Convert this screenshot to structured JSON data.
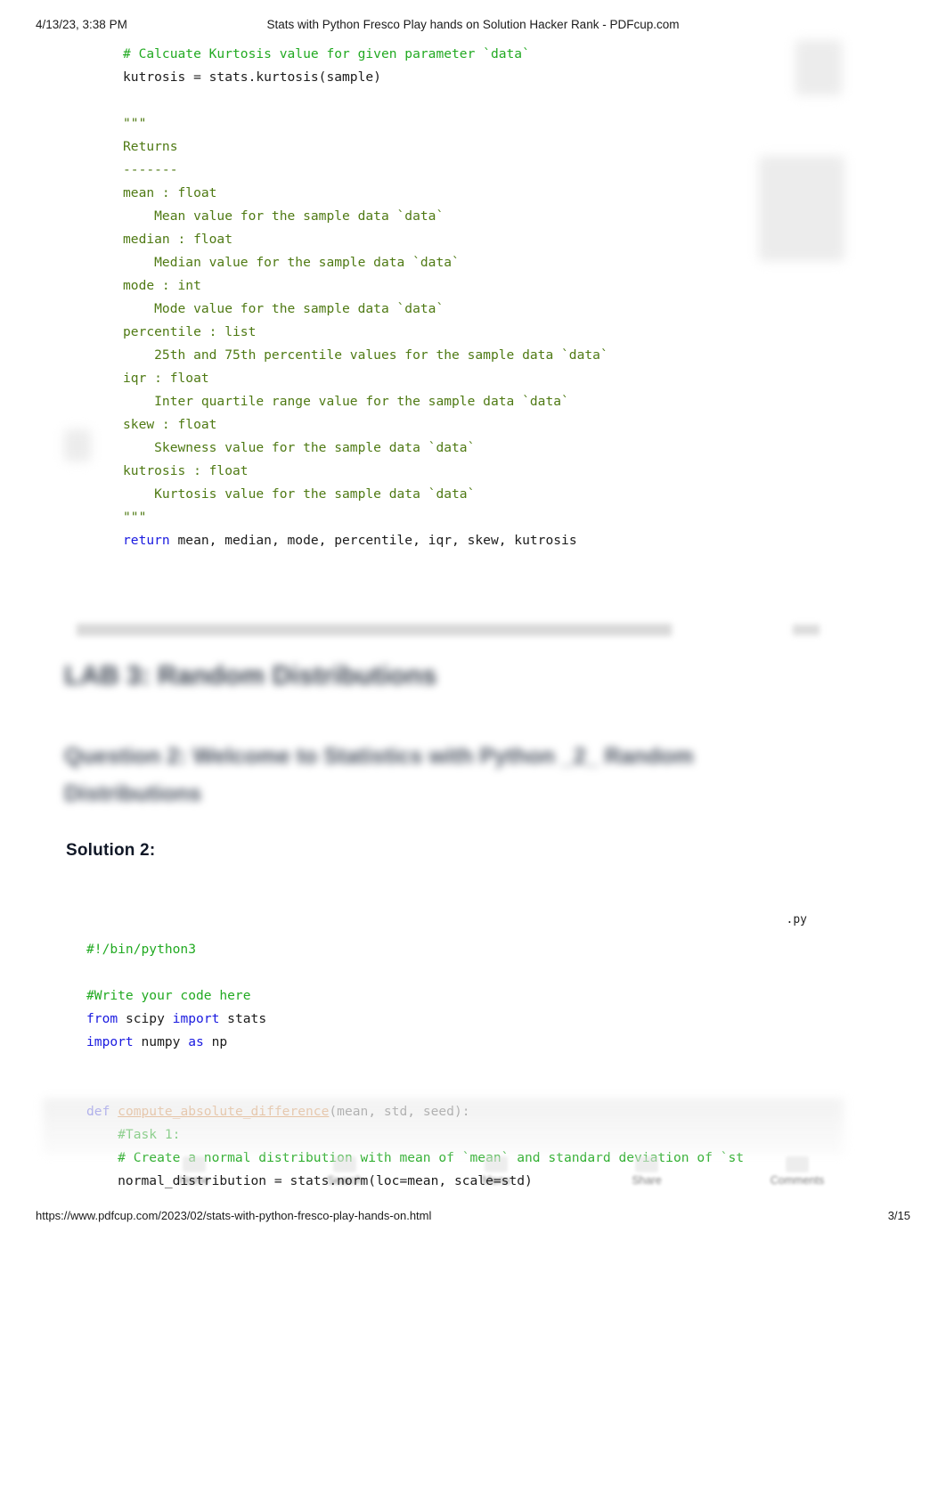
{
  "header": {
    "date": "4/13/23, 3:38 PM",
    "title": "Stats with Python Fresco Play hands on Solution Hacker Rank - PDFcup.com"
  },
  "top_code": {
    "lines": [
      {
        "segments": [
          {
            "t": "# Calcuate Kurtosis value for given parameter `data`",
            "c": "cm"
          }
        ]
      },
      {
        "segments": [
          {
            "t": "kutrosis = stats.kurtosis(sample)",
            "c": "pl"
          }
        ]
      },
      {
        "segments": [
          {
            "t": "",
            "c": "pl"
          }
        ]
      },
      {
        "segments": [
          {
            "t": "\"\"\"",
            "c": "docs"
          }
        ]
      },
      {
        "segments": [
          {
            "t": "Returns",
            "c": "docs"
          }
        ]
      },
      {
        "segments": [
          {
            "t": "-------",
            "c": "docs"
          }
        ]
      },
      {
        "segments": [
          {
            "t": "mean : float",
            "c": "docs"
          }
        ]
      },
      {
        "segments": [
          {
            "t": "    Mean value for the sample data `data`",
            "c": "docs"
          }
        ]
      },
      {
        "segments": [
          {
            "t": "median : float",
            "c": "docs"
          }
        ]
      },
      {
        "segments": [
          {
            "t": "    Median value for the sample data `data`",
            "c": "docs"
          }
        ]
      },
      {
        "segments": [
          {
            "t": "mode : int",
            "c": "docs"
          }
        ]
      },
      {
        "segments": [
          {
            "t": "    Mode value for the sample data `data`",
            "c": "docs"
          }
        ]
      },
      {
        "segments": [
          {
            "t": "percentile : list",
            "c": "docs"
          }
        ]
      },
      {
        "segments": [
          {
            "t": "    25th and 75th percentile values for the sample data `data`",
            "c": "docs"
          }
        ]
      },
      {
        "segments": [
          {
            "t": "iqr : float",
            "c": "docs"
          }
        ]
      },
      {
        "segments": [
          {
            "t": "    Inter quartile range value for the sample data `data`",
            "c": "docs"
          }
        ]
      },
      {
        "segments": [
          {
            "t": "skew : float",
            "c": "docs"
          }
        ]
      },
      {
        "segments": [
          {
            "t": "    Skewness value for the sample data `data`",
            "c": "docs"
          }
        ]
      },
      {
        "segments": [
          {
            "t": "kutrosis : float",
            "c": "docs"
          }
        ]
      },
      {
        "segments": [
          {
            "t": "    Kurtosis value for the sample data `data`",
            "c": "docs"
          }
        ]
      },
      {
        "segments": [
          {
            "t": "\"\"\"",
            "c": "docs"
          }
        ]
      },
      {
        "segments": [
          {
            "t": "return",
            "c": "kw"
          },
          {
            "t": " mean, median, mode, percentile, iqr, skew, kutrosis",
            "c": "pl"
          }
        ]
      }
    ]
  },
  "blurred": {
    "lab_heading": "LAB 3: Random Distributions",
    "question_heading": "Question 2: Welcome to Statistics with Python _2_ Random Distributions"
  },
  "solution": {
    "label": "Solution 2:",
    "file_ext": ".py"
  },
  "bottom_code": {
    "lines": [
      {
        "segments": [
          {
            "t": "#!/bin/python3",
            "c": "cm"
          }
        ]
      },
      {
        "segments": [
          {
            "t": "",
            "c": "pl"
          }
        ]
      },
      {
        "segments": [
          {
            "t": "#Write your code here",
            "c": "cm"
          }
        ]
      },
      {
        "segments": [
          {
            "t": "from",
            "c": "kw"
          },
          {
            "t": " scipy ",
            "c": "pl"
          },
          {
            "t": "import",
            "c": "kw"
          },
          {
            "t": " stats",
            "c": "pl"
          }
        ]
      },
      {
        "segments": [
          {
            "t": "import",
            "c": "kw"
          },
          {
            "t": " numpy ",
            "c": "pl"
          },
          {
            "t": "as",
            "c": "kw"
          },
          {
            "t": " np",
            "c": "pl"
          }
        ]
      },
      {
        "segments": [
          {
            "t": "",
            "c": "pl"
          }
        ]
      },
      {
        "segments": [
          {
            "t": "",
            "c": "pl"
          }
        ]
      },
      {
        "segments": [
          {
            "t": "def",
            "c": "kw"
          },
          {
            "t": " ",
            "c": "pl"
          },
          {
            "t": "compute_absolute_difference",
            "c": "fn"
          },
          {
            "t": "(mean, std, seed):",
            "c": "pl"
          }
        ]
      },
      {
        "segments": [
          {
            "t": "    #Task 1:",
            "c": "cm"
          }
        ]
      },
      {
        "segments": [
          {
            "t": "    # Create a normal distribution with mean of `mean` and standard deviation of `st",
            "c": "cm"
          }
        ]
      },
      {
        "segments": [
          {
            "t": "    normal_distribution = stats.norm(loc=mean, scale=std)",
            "c": "pl"
          }
        ]
      }
    ]
  },
  "toolbar": {
    "items": [
      {
        "label": "Home"
      },
      {
        "label": "Search"
      },
      {
        "label": "Menu"
      },
      {
        "label": "Share"
      },
      {
        "label": "Comments"
      }
    ]
  },
  "footer": {
    "url": "https://www.pdfcup.com/2023/02/stats-with-python-fresco-play-hands-on.html",
    "page": "3/15"
  },
  "colors": {
    "comment_green": "#22aa22",
    "docstring_olive": "#4f7a14",
    "keyword_blue": "#1a1ae0",
    "function_orange": "#d06b12",
    "plain_text": "#1b1b1b"
  }
}
